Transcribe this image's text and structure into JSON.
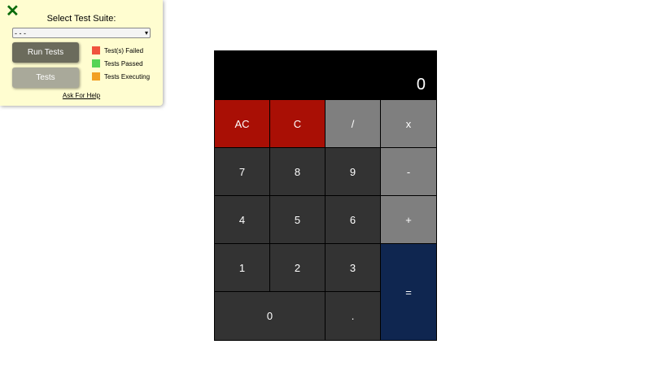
{
  "test_panel": {
    "close_icon": "✕",
    "title": "Select Test Suite:",
    "select_value": "- - -",
    "run_tests_label": "Run Tests",
    "tests_label": "Tests",
    "legend": [
      {
        "label": "Test(s) Failed",
        "color": "#f0533e"
      },
      {
        "label": "Tests Passed",
        "color": "#55d455"
      },
      {
        "label": "Tests Executing",
        "color": "#f2a024"
      }
    ],
    "help_link": "Ask For Help"
  },
  "calculator": {
    "display_value": "0",
    "keys": {
      "ac": "AC",
      "clear": "C",
      "divide": "/",
      "multiply": "x",
      "seven": "7",
      "eight": "8",
      "nine": "9",
      "subtract": "-",
      "four": "4",
      "five": "5",
      "six": "6",
      "add": "+",
      "one": "1",
      "two": "2",
      "three": "3",
      "equals": "=",
      "zero": "0",
      "decimal": "."
    }
  }
}
